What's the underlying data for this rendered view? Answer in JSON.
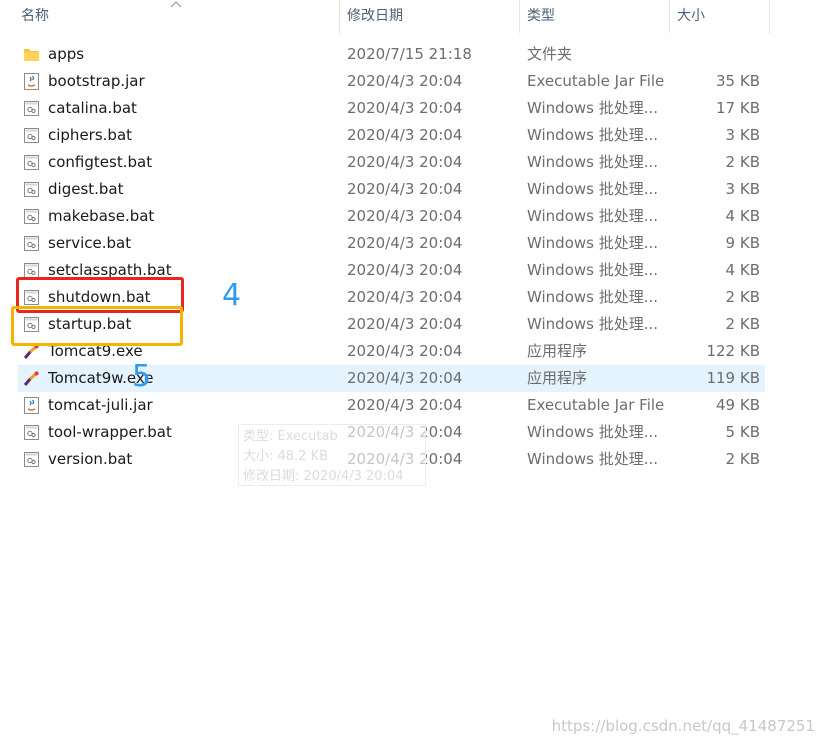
{
  "columns": {
    "name": "名称",
    "date": "修改日期",
    "type": "类型",
    "size": "大小"
  },
  "files": [
    {
      "icon": "folder-icon",
      "name": "apps",
      "date": "2020/7/15 21:18",
      "type": "文件夹",
      "size": ""
    },
    {
      "icon": "jar-icon",
      "name": "bootstrap.jar",
      "date": "2020/4/3 20:04",
      "type": "Executable Jar File",
      "size": "35 KB"
    },
    {
      "icon": "bat-icon",
      "name": "catalina.bat",
      "date": "2020/4/3 20:04",
      "type": "Windows 批处理...",
      "size": "17 KB"
    },
    {
      "icon": "bat-icon",
      "name": "ciphers.bat",
      "date": "2020/4/3 20:04",
      "type": "Windows 批处理...",
      "size": "3 KB"
    },
    {
      "icon": "bat-icon",
      "name": "configtest.bat",
      "date": "2020/4/3 20:04",
      "type": "Windows 批处理...",
      "size": "2 KB"
    },
    {
      "icon": "bat-icon",
      "name": "digest.bat",
      "date": "2020/4/3 20:04",
      "type": "Windows 批处理...",
      "size": "3 KB"
    },
    {
      "icon": "bat-icon",
      "name": "makebase.bat",
      "date": "2020/4/3 20:04",
      "type": "Windows 批处理...",
      "size": "4 KB"
    },
    {
      "icon": "bat-icon",
      "name": "service.bat",
      "date": "2020/4/3 20:04",
      "type": "Windows 批处理...",
      "size": "9 KB"
    },
    {
      "icon": "bat-icon",
      "name": "setclasspath.bat",
      "date": "2020/4/3 20:04",
      "type": "Windows 批处理...",
      "size": "4 KB"
    },
    {
      "icon": "bat-icon",
      "name": "shutdown.bat",
      "date": "2020/4/3 20:04",
      "type": "Windows 批处理...",
      "size": "2 KB"
    },
    {
      "icon": "bat-icon",
      "name": "startup.bat",
      "date": "2020/4/3 20:04",
      "type": "Windows 批处理...",
      "size": "2 KB"
    },
    {
      "icon": "tomcat-exe-icon",
      "name": "Tomcat9.exe",
      "date": "2020/4/3 20:04",
      "type": "应用程序",
      "size": "122 KB"
    },
    {
      "icon": "tomcat-exe-icon",
      "name": "Tomcat9w.exe",
      "date": "2020/4/3 20:04",
      "type": "应用程序",
      "size": "119 KB"
    },
    {
      "icon": "jar-icon",
      "name": "tomcat-juli.jar",
      "date": "2020/4/3 20:04",
      "type": "Executable Jar File",
      "size": "49 KB"
    },
    {
      "icon": "bat-icon",
      "name": "tool-wrapper.bat",
      "date": "2020/4/3 20:04",
      "type": "Windows 批处理...",
      "size": "5 KB"
    },
    {
      "icon": "bat-icon",
      "name": "version.bat",
      "date": "2020/4/3 20:04",
      "type": "Windows 批处理...",
      "size": "2 KB"
    }
  ],
  "annotations": [
    {
      "label": "4",
      "color": "#e8261c"
    },
    {
      "label": "5",
      "color": "#f5b400"
    }
  ],
  "tooltip": {
    "line1": "类型: Executab",
    "line2": "大小: 48.2 KB",
    "line3": "修改日期: 2020/4/3 20:04"
  },
  "watermark": "https://blog.csdn.net/qq_41487251",
  "colors": {
    "hover_row": "#e5f3ff",
    "accent": "#2e9cf2"
  }
}
